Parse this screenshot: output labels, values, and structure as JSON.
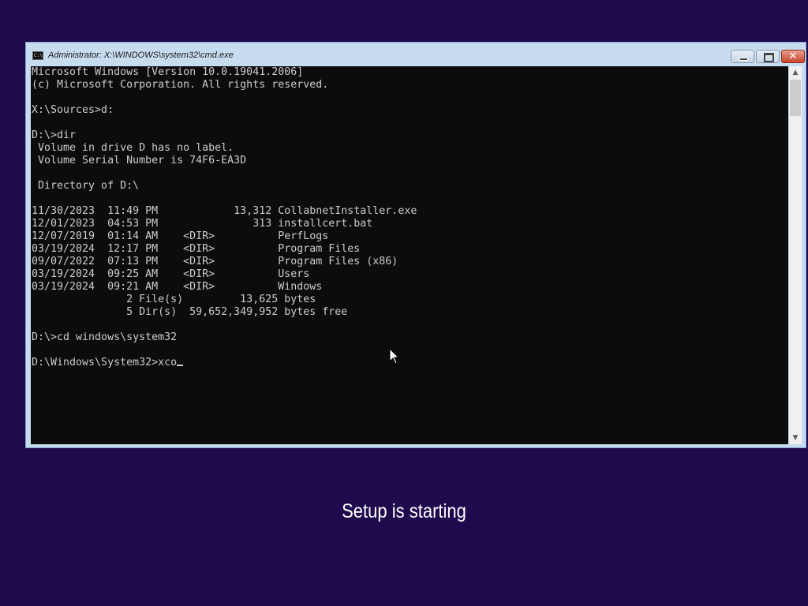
{
  "window": {
    "title": "Administrator: X:\\WINDOWS\\system32\\cmd.exe",
    "icon_label": "C:\\"
  },
  "console": {
    "lines": [
      "Microsoft Windows [Version 10.0.19041.2006]",
      "(c) Microsoft Corporation. All rights reserved.",
      "",
      "X:\\Sources>d:",
      "",
      "D:\\>dir",
      " Volume in drive D has no label.",
      " Volume Serial Number is 74F6-EA3D",
      "",
      " Directory of D:\\",
      "",
      "11/30/2023  11:49 PM            13,312 CollabnetInstaller.exe",
      "12/01/2023  04:53 PM               313 installcert.bat",
      "12/07/2019  01:14 AM    <DIR>          PerfLogs",
      "03/19/2024  12:17 PM    <DIR>          Program Files",
      "09/07/2022  07:13 PM    <DIR>          Program Files (x86)",
      "03/19/2024  09:25 AM    <DIR>          Users",
      "03/19/2024  09:21 AM    <DIR>          Windows",
      "               2 File(s)         13,625 bytes",
      "               5 Dir(s)  59,652,349,952 bytes free",
      "",
      "D:\\>cd windows\\system32",
      ""
    ],
    "prompt": "D:\\Windows\\System32>",
    "input": "xco"
  },
  "status": {
    "setup_text": "Setup is starting"
  },
  "colors": {
    "desktop_background": "#1e0a4c",
    "console_background": "#0c0c0c",
    "console_text": "#cccccc"
  }
}
